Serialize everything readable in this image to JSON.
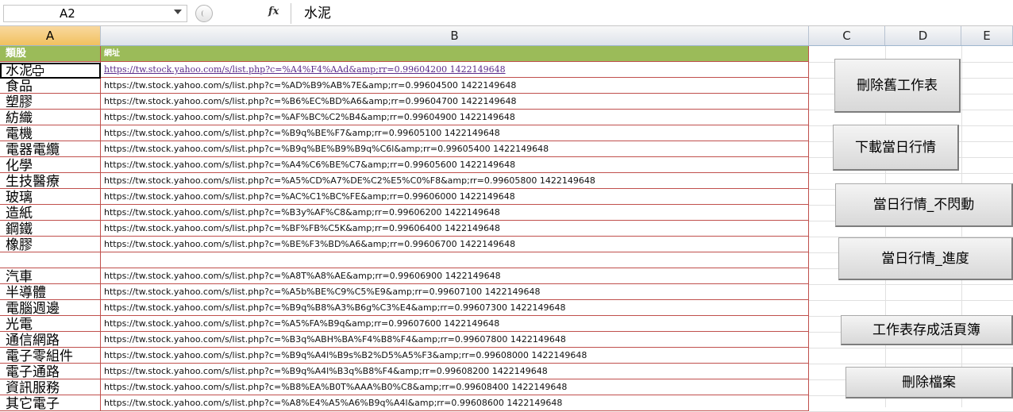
{
  "formula_bar": {
    "name_box": "A2",
    "fx_label": "fx",
    "formula": "水泥"
  },
  "columns": [
    "A",
    "B",
    "C",
    "D",
    "E"
  ],
  "header_row": {
    "a": "類股",
    "b": "網址"
  },
  "rows": [
    {
      "a": "水泥",
      "b": "https://tw.stock.yahoo.com/s/list.php?c=%A4%F4%AAd&amp;rr=0.99604200 1422149648",
      "link": true
    },
    {
      "a": "食品",
      "b": "https://tw.stock.yahoo.com/s/list.php?c=%AD%B9%AB%7E&amp;rr=0.99604500 1422149648"
    },
    {
      "a": "塑膠",
      "b": "https://tw.stock.yahoo.com/s/list.php?c=%B6%EC%BD%A6&amp;rr=0.99604700 1422149648"
    },
    {
      "a": "紡織",
      "b": "https://tw.stock.yahoo.com/s/list.php?c=%AF%BC%C2%B4&amp;rr=0.99604900 1422149648"
    },
    {
      "a": "電機",
      "b": "https://tw.stock.yahoo.com/s/list.php?c=%B9q%BE%F7&amp;rr=0.99605100 1422149648"
    },
    {
      "a": "電器電纜",
      "b": "https://tw.stock.yahoo.com/s/list.php?c=%B9q%BE%B9%B9q%C6l&amp;rr=0.99605400 1422149648"
    },
    {
      "a": "化學",
      "b": "https://tw.stock.yahoo.com/s/list.php?c=%A4%C6%BE%C7&amp;rr=0.99605600 1422149648"
    },
    {
      "a": "生技醫療",
      "b": "https://tw.stock.yahoo.com/s/list.php?c=%A5%CD%A7%DE%C2%E5%C0%F8&amp;rr=0.99605800 1422149648"
    },
    {
      "a": "玻璃",
      "b": "https://tw.stock.yahoo.com/s/list.php?c=%AC%C1%BC%FE&amp;rr=0.99606000 1422149648"
    },
    {
      "a": "造紙",
      "b": "https://tw.stock.yahoo.com/s/list.php?c=%B3y%AF%C8&amp;rr=0.99606200 1422149648"
    },
    {
      "a": "鋼鐵",
      "b": "https://tw.stock.yahoo.com/s/list.php?c=%BF%FB%C5K&amp;rr=0.99606400 1422149648"
    },
    {
      "a": "橡膠",
      "b": "https://tw.stock.yahoo.com/s/list.php?c=%BE%F3%BD%A6&amp;rr=0.99606700 1422149648"
    },
    {
      "a": "",
      "b": ""
    },
    {
      "a": "汽車",
      "b": "https://tw.stock.yahoo.com/s/list.php?c=%A8T%A8%AE&amp;rr=0.99606900 1422149648"
    },
    {
      "a": "半導體",
      "b": "https://tw.stock.yahoo.com/s/list.php?c=%A5b%BE%C9%C5%E9&amp;rr=0.99607100 1422149648"
    },
    {
      "a": "電腦週邊",
      "b": "https://tw.stock.yahoo.com/s/list.php?c=%B9q%B8%A3%B6g%C3%E4&amp;rr=0.99607300 1422149648"
    },
    {
      "a": "光電",
      "b": "https://tw.stock.yahoo.com/s/list.php?c=%A5%FA%B9q&amp;rr=0.99607600 1422149648"
    },
    {
      "a": "通信網路",
      "b": "https://tw.stock.yahoo.com/s/list.php?c=%B3q%ABH%BA%F4%B8%F4&amp;rr=0.99607800 1422149648"
    },
    {
      "a": "電子零組件",
      "b": "https://tw.stock.yahoo.com/s/list.php?c=%B9q%A4l%B9s%B2%D5%A5%F3&amp;rr=0.99608000 1422149648"
    },
    {
      "a": "電子通路",
      "b": "https://tw.stock.yahoo.com/s/list.php?c=%B9q%A4l%B3q%B8%F4&amp;rr=0.99608200 1422149648"
    },
    {
      "a": "資訊服務",
      "b": "https://tw.stock.yahoo.com/s/list.php?c=%B8%EA%B0T%AAA%B0%C8&amp;rr=0.99608400 1422149648"
    },
    {
      "a": "其它電子",
      "b": "https://tw.stock.yahoo.com/s/list.php?c=%A8%E4%A5%A6%B9q%A4l&amp;rr=0.99608600 1422149648"
    }
  ],
  "buttons": {
    "delete_old_sheet": "刪除舊工作表",
    "download_today": "下載當日行情",
    "today_no_flicker": "當日行情_不閃動",
    "today_progress": "當日行情_進度",
    "save_sheet_workbook": "工作表存成活頁簿",
    "delete_file": "刪除檔案"
  },
  "colors": {
    "header_fill": "#9bbb59",
    "cell_border": "#c0504d",
    "selected_col_header": "#f1c15f"
  }
}
